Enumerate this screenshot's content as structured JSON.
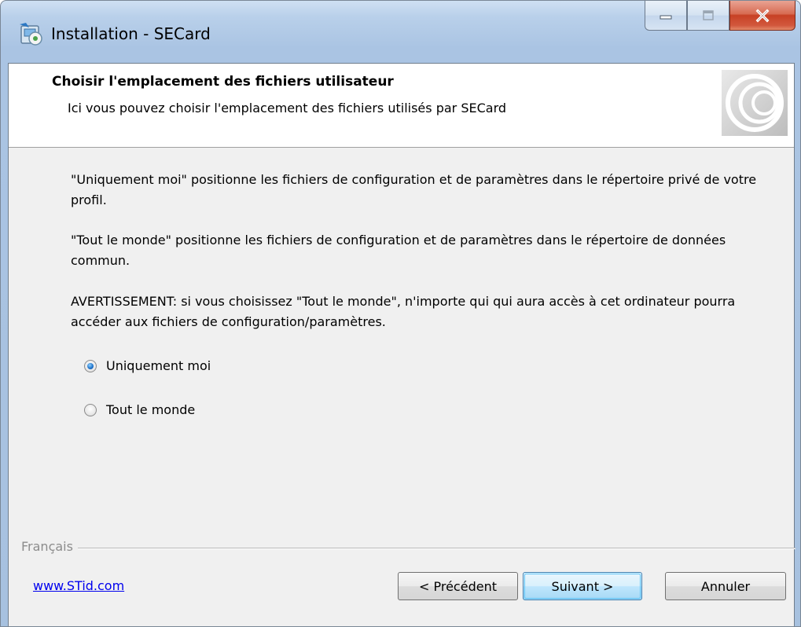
{
  "window": {
    "title": "Installation - SECard",
    "icon": "installer-icon",
    "caption_buttons": [
      "minimize-icon",
      "maximize-icon",
      "close-icon"
    ]
  },
  "header": {
    "title": "Choisir l'emplacement des fichiers utilisateur",
    "subtitle": "Ici vous pouvez choisir l'emplacement des fichiers utilisés par SECard",
    "logo": "concentric-circles-logo"
  },
  "body": {
    "paragraphs": [
      " \"Uniquement moi\" positionne les fichiers de configuration et de paramètres dans le répertoire privé de votre profil.",
      "\"Tout le monde\" positionne les fichiers de configuration et de paramètres dans le répertoire de données commun.",
      " AVERTISSEMENT:  si vous choisissez \"Tout le monde\", n'importe qui qui aura accès à cet ordinateur pourra accéder aux fichiers de configuration/paramètres."
    ],
    "options": [
      {
        "label": "Uniquement moi",
        "checked": true
      },
      {
        "label": "Tout le monde",
        "checked": false
      }
    ]
  },
  "footer": {
    "language_label": "Français",
    "website_link": "www.STid.com",
    "buttons": {
      "previous": "< Précédent",
      "next": "Suivant >",
      "cancel": "Annuler"
    }
  },
  "colors": {
    "link": "#0000ee",
    "default_button_border": "#3c7fb1",
    "close_button": "#c74124"
  }
}
